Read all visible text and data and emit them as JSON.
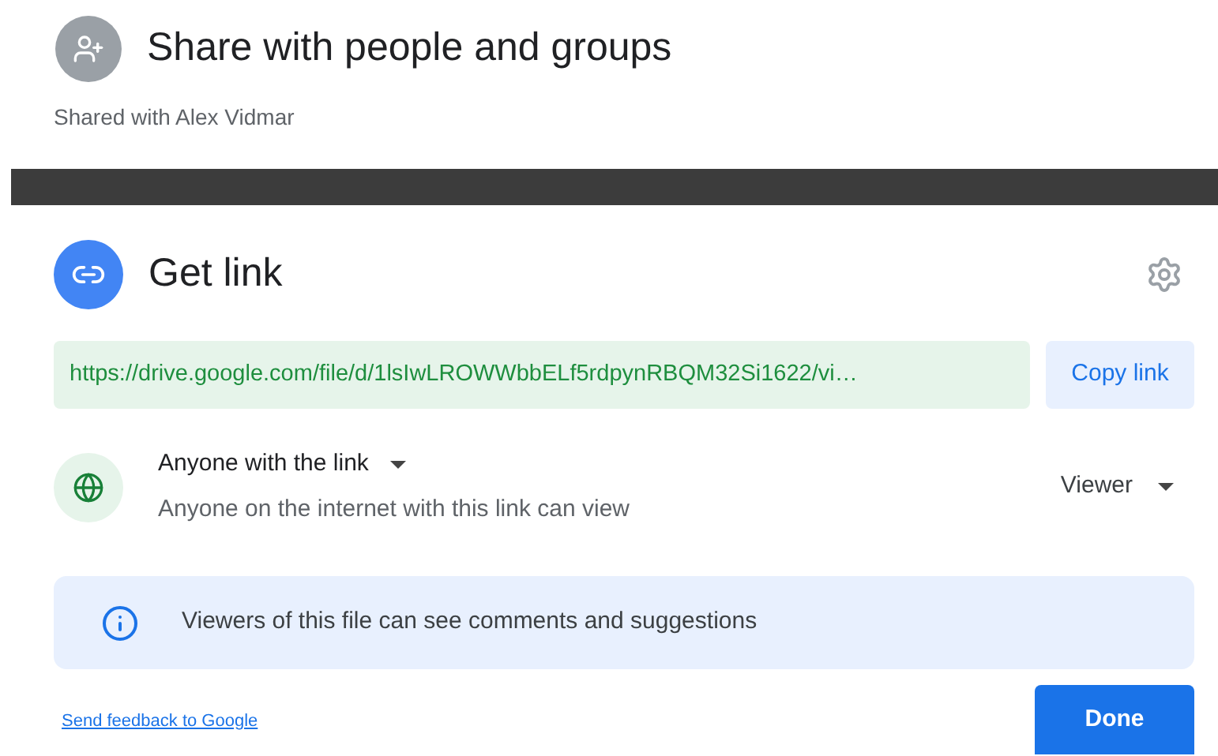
{
  "share_section": {
    "title": "Share with people and groups",
    "subtitle": "Shared with Alex Vidmar"
  },
  "link_section": {
    "title": "Get link",
    "url": "https://drive.google.com/file/d/1lsIwLROWWbbELf5rdpynRBQM32Si1622/vi…",
    "copy_button": "Copy link",
    "access": {
      "scope": "Anyone with the link",
      "description": "Anyone on the internet with this link can view",
      "role": "Viewer"
    },
    "info": "Viewers of this file can see comments and suggestions",
    "feedback_link": "Send feedback to Google",
    "done_button": "Done"
  }
}
